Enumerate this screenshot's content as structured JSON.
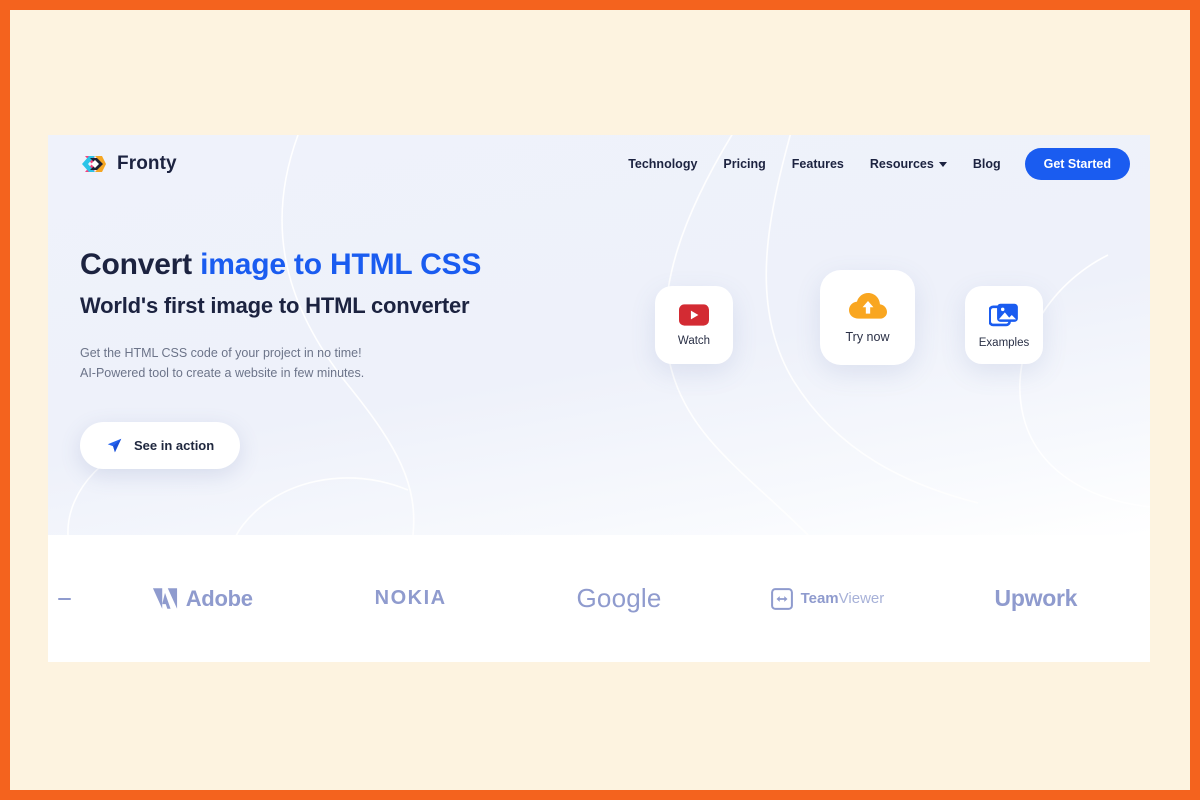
{
  "frame": {
    "border_color": "#f4631e",
    "canvas_color": "#fdf3e0"
  },
  "brand": {
    "name": "Fronty",
    "logo_icon": "fronty-hexagon-logo-icon"
  },
  "nav": {
    "links": [
      {
        "label": "Technology",
        "has_dropdown": false
      },
      {
        "label": "Pricing",
        "has_dropdown": false
      },
      {
        "label": "Features",
        "has_dropdown": false
      },
      {
        "label": "Resources",
        "has_dropdown": true
      },
      {
        "label": "Blog",
        "has_dropdown": false
      }
    ],
    "cta": {
      "label": "Get Started",
      "color": "#1a5cf0"
    }
  },
  "hero": {
    "headline_plain": "Convert ",
    "headline_accent": "image to HTML CSS",
    "subheadline": "World's first image to HTML converter",
    "paragraph_line1": "Get the HTML CSS code of your project in no time!",
    "paragraph_line2": "AI-Powered tool to create a website in few minutes.",
    "action_button": {
      "label": "See in action",
      "icon": "send-plane-icon"
    },
    "tiles": [
      {
        "label": "Watch",
        "icon": "youtube-play-icon",
        "color": "#d32b33"
      },
      {
        "label": "Try now",
        "icon": "cloud-upload-icon",
        "color": "#f9a620"
      },
      {
        "label": "Examples",
        "icon": "image-gallery-icon",
        "color": "#1a5cf0"
      }
    ]
  },
  "logos": {
    "color": "#8f9bce",
    "items": [
      {
        "name": "Adobe"
      },
      {
        "name": "NOKIA"
      },
      {
        "name": "Google"
      },
      {
        "name": "TeamViewer",
        "bold_part": "Team",
        "light_part": "Viewer"
      },
      {
        "name": "Upwork"
      }
    ]
  }
}
